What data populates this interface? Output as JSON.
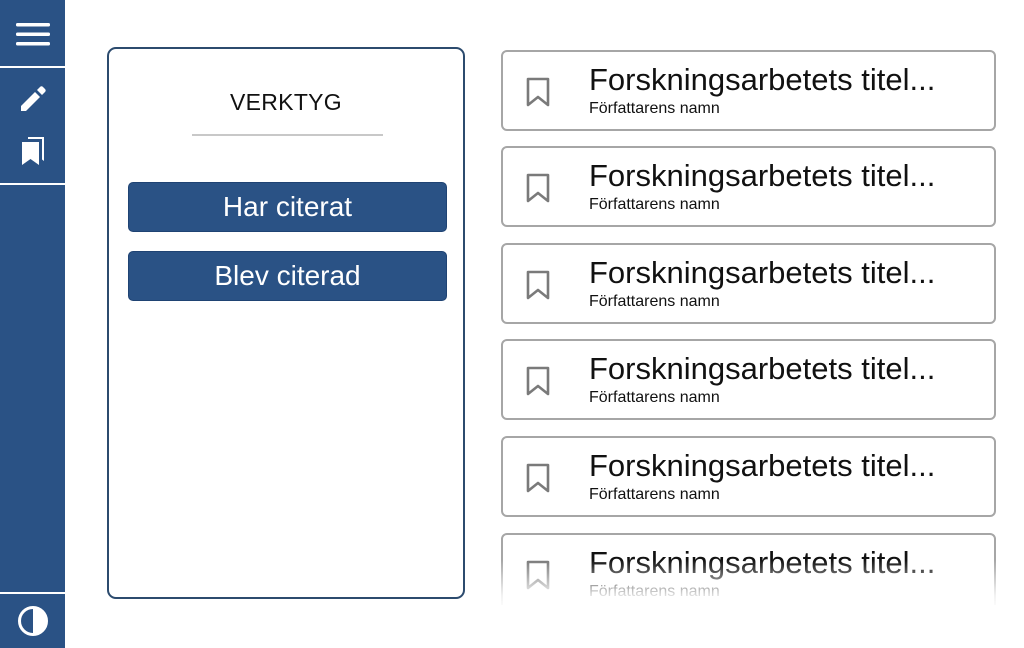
{
  "sidebar": {
    "items": [
      {
        "icon": "hamburger-menu-icon"
      },
      {
        "icon": "pencil-icon"
      },
      {
        "icon": "bookmarks-icon"
      },
      {
        "icon": "contrast-icon"
      }
    ],
    "color": "#2a5285"
  },
  "tools": {
    "title": "VERKTYG",
    "buttons": [
      {
        "label": "Har citerat"
      },
      {
        "label": "Blev citerad"
      }
    ]
  },
  "results": [
    {
      "title": "Forskningsarbetets titel...",
      "author": "Författarens namn"
    },
    {
      "title": "Forskningsarbetets titel...",
      "author": "Författarens namn"
    },
    {
      "title": "Forskningsarbetets titel...",
      "author": "Författarens namn"
    },
    {
      "title": "Forskningsarbetets titel...",
      "author": "Författarens namn"
    },
    {
      "title": "Forskningsarbetets titel...",
      "author": "Författarens namn"
    },
    {
      "title": "Forskningsarbetets titel...",
      "author": "Författarens namn"
    }
  ]
}
